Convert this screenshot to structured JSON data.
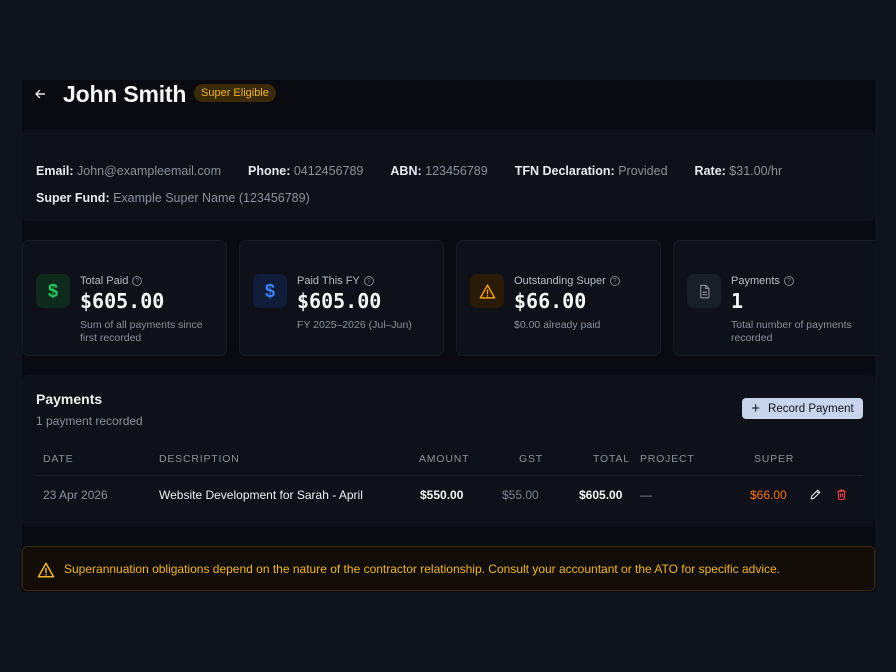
{
  "header": {
    "title": "John Smith",
    "badge": "Super Eligible"
  },
  "info": {
    "row1": [
      {
        "key": "Email:",
        "value": "John@exampleemail.com"
      },
      {
        "key": "Phone:",
        "value": "0412456789"
      },
      {
        "key": "ABN:",
        "value": "123456789"
      },
      {
        "key": "TFN Declaration:",
        "value": "Provided"
      },
      {
        "key": "Rate:",
        "value": "$31.00/hr"
      }
    ],
    "row2": [
      {
        "key": "Super Fund:",
        "value": "Example Super Name (123456789)"
      }
    ]
  },
  "stats": [
    {
      "label": "Total Paid",
      "value": "$605.00",
      "sub": "Sum of all payments since first recorded",
      "icon": "dollar-icon",
      "color": "#22c55e"
    },
    {
      "label": "Paid This FY",
      "value": "$605.00",
      "sub": "FY 2025–2026 (Jul–Jun)",
      "icon": "dollar-icon",
      "color": "#3b82f6"
    },
    {
      "label": "Outstanding Super",
      "value": "$66.00",
      "sub": "$0.00 already paid",
      "icon": "warning-icon",
      "color": "#f59e0b"
    },
    {
      "label": "Payments",
      "value": "1",
      "sub": "Total number of payments recorded",
      "icon": "document-icon",
      "color": "#8a909c"
    }
  ],
  "payments": {
    "title": "Payments",
    "subtitle": "1 payment recorded",
    "record_label": "Record Payment",
    "columns": {
      "date": "DATE",
      "description": "DESCRIPTION",
      "amount": "AMOUNT",
      "gst": "GST",
      "total": "TOTAL",
      "project": "PROJECT",
      "super": "SUPER"
    },
    "rows": [
      {
        "date": "23 Apr 2026",
        "description": "Website Development for Sarah - April",
        "amount": "$550.00",
        "gst": "$55.00",
        "total": "$605.00",
        "project": "—",
        "super": "$66.00"
      }
    ]
  },
  "warning": {
    "text": "Superannuation obligations depend on the nature of the contractor relationship. Consult your accountant or the ATO for specific advice."
  },
  "colors": {
    "accent_gold": "#f0b429",
    "super_orange": "#f97316",
    "delete_red": "#ef4444"
  }
}
